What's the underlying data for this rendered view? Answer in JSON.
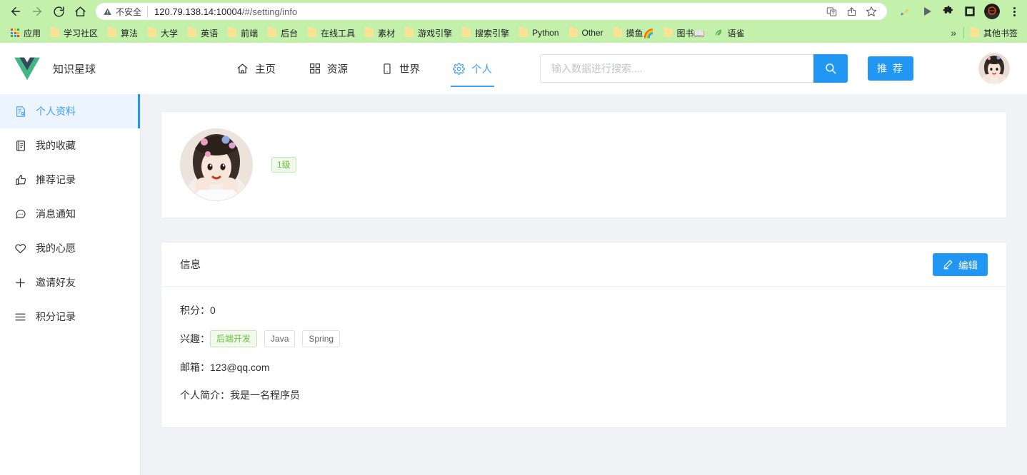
{
  "browser": {
    "nav_buttons": [
      {
        "name": "back-button",
        "glyph": "back"
      },
      {
        "name": "forward-button",
        "glyph": "forward"
      },
      {
        "name": "reload-button",
        "glyph": "reload"
      },
      {
        "name": "home-button",
        "glyph": "home"
      }
    ],
    "security_label": "不安全",
    "url": "120.79.138.14:10004",
    "url_path": "/#/setting/info",
    "omnibox_icons": [
      "translate-icon",
      "share-icon",
      "bookmark-star-icon"
    ],
    "extension_icons": [
      "brush-extension-icon",
      "play-extension-icon",
      "puzzle-extension-icon",
      "square-extension-icon"
    ],
    "overflow_label": "»",
    "bookmarks": [
      {
        "label": "应用",
        "icon": "apps-grid-icon"
      },
      {
        "label": "学习社区",
        "icon": "folder-icon"
      },
      {
        "label": "算法",
        "icon": "folder-icon"
      },
      {
        "label": "大学",
        "icon": "folder-icon"
      },
      {
        "label": "英语",
        "icon": "folder-icon"
      },
      {
        "label": "前端",
        "icon": "folder-icon"
      },
      {
        "label": "后台",
        "icon": "folder-icon"
      },
      {
        "label": "在线工具",
        "icon": "folder-icon"
      },
      {
        "label": "素材",
        "icon": "folder-icon"
      },
      {
        "label": "游戏引擎",
        "icon": "folder-icon"
      },
      {
        "label": "搜索引擎",
        "icon": "folder-icon"
      },
      {
        "label": "Python",
        "icon": "folder-icon"
      },
      {
        "label": "Other",
        "icon": "folder-icon"
      },
      {
        "label": "摸鱼🌈",
        "icon": "folder-icon"
      },
      {
        "label": "图书📖",
        "icon": "folder-icon"
      },
      {
        "label": "语雀",
        "icon": "yuque-leaf-icon"
      }
    ],
    "other_bookmarks": {
      "label": "其他书签",
      "icon": "folder-icon"
    }
  },
  "header": {
    "brand_name": "知识星球",
    "logo": "vue-logo-icon",
    "nav": [
      {
        "label": "主页",
        "icon": "home-icon",
        "active": false
      },
      {
        "label": "资源",
        "icon": "grid-icon",
        "active": false
      },
      {
        "label": "世界",
        "icon": "book-icon",
        "active": false
      },
      {
        "label": "个人",
        "icon": "gear-icon",
        "active": true
      }
    ],
    "search": {
      "placeholder": "输入数据进行搜索....",
      "value": "",
      "button_icon": "search-icon"
    },
    "recommend_label": "推 荐",
    "avatar": "user-avatar"
  },
  "sidebar": {
    "items": [
      {
        "label": "个人资料",
        "icon": "profile-doc-icon",
        "active": true
      },
      {
        "label": "我的收藏",
        "icon": "collection-icon",
        "active": false
      },
      {
        "label": "推荐记录",
        "icon": "thumbs-up-icon",
        "active": false
      },
      {
        "label": "消息通知",
        "icon": "chat-bubble-icon",
        "active": false
      },
      {
        "label": "我的心愿",
        "icon": "heart-icon",
        "active": false
      },
      {
        "label": "邀请好友",
        "icon": "plus-icon",
        "active": false
      },
      {
        "label": "积分记录",
        "icon": "list-lines-icon",
        "active": false
      }
    ]
  },
  "profile_card": {
    "avatar": "user-avatar-large",
    "level_badge": "1级"
  },
  "info_card": {
    "title": "信息",
    "edit_label": "编辑",
    "edit_icon": "pencil-icon",
    "rows": [
      {
        "label": "积分：",
        "value": "0",
        "type": "text"
      },
      {
        "label": "兴趣：",
        "type": "tags",
        "tags": [
          {
            "text": "后端开发",
            "style": "green"
          },
          {
            "text": "Java",
            "style": "plain"
          },
          {
            "text": "Spring",
            "style": "plain"
          }
        ]
      },
      {
        "label": "邮箱：",
        "value": "123@qq.com",
        "type": "text"
      },
      {
        "label": "个人简介：",
        "value": "我是一名程序员",
        "type": "text"
      }
    ]
  },
  "colors": {
    "accent_blue": "#2196f3",
    "element_blue": "#409eff",
    "active_bg": "#ecf5ff",
    "content_bg": "#f0f2f5",
    "tag_green": "#67c23a",
    "chrome_green": "#c3f0ab"
  }
}
